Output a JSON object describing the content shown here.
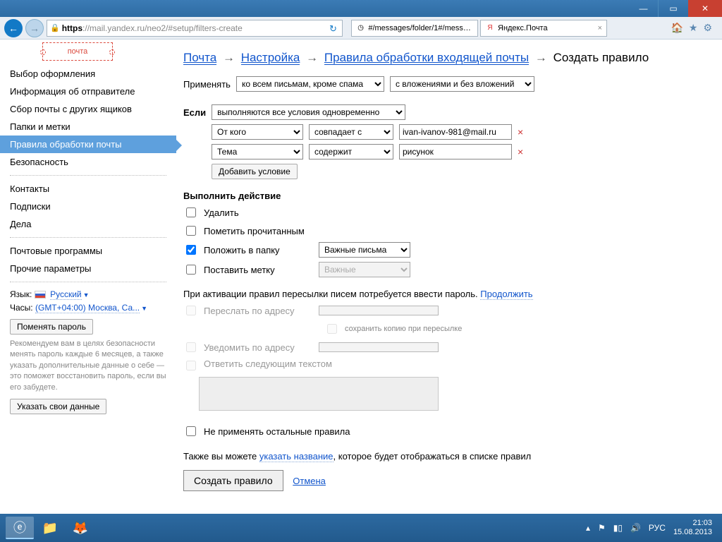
{
  "window": {
    "minimize": "—",
    "maximize": "▭",
    "close": "✕"
  },
  "addrbar": {
    "scheme": "https",
    "url_rest": "://mail.yandex.ru/neo2/#setup/filters-create",
    "tab1": "#/messages/folder/1#/messag...",
    "tab2": "Яндекс.Почта",
    "tab2_close": "×"
  },
  "sidebar": {
    "logo": "почта",
    "items": [
      "Выбор оформления",
      "Информация об отправителе",
      "Сбор почты с других ящиков",
      "Папки и метки",
      "Правила обработки почты",
      "Безопасность"
    ],
    "items2": [
      "Контакты",
      "Подписки",
      "Дела"
    ],
    "items3": [
      "Почтовые программы",
      "Прочие параметры"
    ],
    "lang_label": "Язык:",
    "lang": "Русский",
    "tz_label": "Часы:",
    "tz": "(GMT+04:00) Москва, Са...",
    "change_pw": "Поменять пароль",
    "hint": "Рекомендуем вам в целях безопасности менять пароль каждые 6 месяцев, а также указать дополнительные данные о себе — это поможет восстановить пароль, если вы его забудете.",
    "fill_data": "Указать свои данные"
  },
  "crumbs": {
    "c1": "Почта",
    "c2": "Настройка",
    "c3": "Правила обработки входящей почты",
    "c4": "Создать правило",
    "ar": "→"
  },
  "apply": {
    "label": "Применять",
    "scope": "ко всем письмам, кроме спама",
    "attach": "с вложениями и без вложений"
  },
  "if": {
    "label": "Если",
    "mode": "выполняются все условия одновременно",
    "cond": [
      {
        "field": "От кого",
        "op": "совпадает с",
        "val": "ivan-ivanov-981@mail.ru"
      },
      {
        "field": "Тема",
        "op": "содержит",
        "val": "рисунок"
      }
    ],
    "add": "Добавить условие"
  },
  "act": {
    "header": "Выполнить действие",
    "delete": "Удалить",
    "markread": "Пометить прочитанным",
    "tofolder": "Положить в папку",
    "folder": "Важные письма",
    "setlabel": "Поставить метку",
    "label": "Важные",
    "fw_note": "При активации правил пересылки писем потребуется ввести пароль.",
    "continue": "Продолжить",
    "forward": "Переслать по адресу",
    "savecopy": "сохранить копию при пересылке",
    "notify": "Уведомить по адресу",
    "reply": "Ответить следующим текстом",
    "noother": "Не применять остальные правила",
    "also": "Также вы можете ",
    "name_link": "указать название",
    "also2": ", которое будет отображаться в списке правил",
    "create": "Создать правило",
    "cancel": "Отмена"
  },
  "taskbar": {
    "lang": "РУС",
    "time": "21:03",
    "date": "15.08.2013"
  }
}
